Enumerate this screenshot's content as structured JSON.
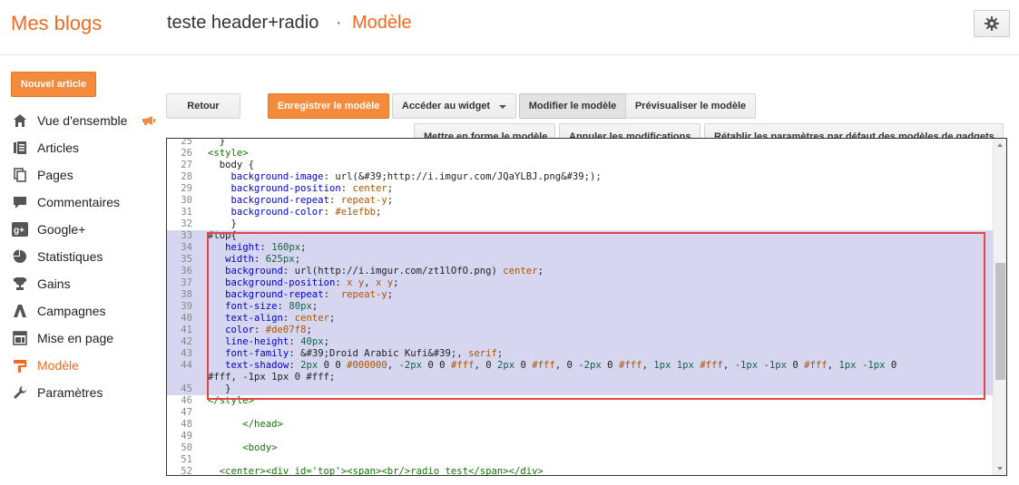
{
  "header": {
    "app_title": "Mes blogs",
    "blog_name": "teste header+radio",
    "separator": "·",
    "section": "Modèle"
  },
  "sidebar": {
    "new_post": "Nouvel article",
    "items": [
      {
        "label": "Vue d'ensemble",
        "icon": "overview-icon"
      },
      {
        "label": "Articles",
        "icon": "posts-icon"
      },
      {
        "label": "Pages",
        "icon": "pages-icon"
      },
      {
        "label": "Commentaires",
        "icon": "comments-icon"
      },
      {
        "label": "Google+",
        "icon": "google-plus-icon"
      },
      {
        "label": "Statistiques",
        "icon": "stats-icon"
      },
      {
        "label": "Gains",
        "icon": "earnings-icon"
      },
      {
        "label": "Campagnes",
        "icon": "campaigns-icon"
      },
      {
        "label": "Mise en page",
        "icon": "layout-icon"
      },
      {
        "label": "Modèle",
        "icon": "template-icon",
        "active": true
      },
      {
        "label": "Paramètres",
        "icon": "settings-icon"
      }
    ]
  },
  "toolbar": {
    "back": "Retour",
    "save": "Enregistrer le modèle",
    "goto_widget": "Accéder au widget",
    "edit": "Modifier le modèle",
    "preview": "Prévisualiser le modèle",
    "format": "Mettre en forme le modèle",
    "undo": "Annuler les modifications",
    "reset_gadgets": "Rétablir les paramètres par défaut des modèles de gadgets"
  },
  "colors": {
    "accent": "#f06b22",
    "button_orange": "#f48a3b",
    "selection": "#d6d6f0",
    "highlight_border": "#e04848"
  },
  "code": {
    "lines": [
      {
        "n": "25",
        "t": "  }"
      },
      {
        "n": "26",
        "t": "<style>"
      },
      {
        "n": "27",
        "t": "  body {"
      },
      {
        "n": "28",
        "t": "    background-image: url(&#39;http://i.imgur.com/JQaYLBJ.png&#39;);"
      },
      {
        "n": "29",
        "t": "    background-position: center;"
      },
      {
        "n": "30",
        "t": "    background-repeat: repeat-y;"
      },
      {
        "n": "31",
        "t": "    background-color: #e1efbb;"
      },
      {
        "n": "32",
        "t": "    }"
      },
      {
        "n": "33",
        "t": "#top{"
      },
      {
        "n": "34",
        "t": "   height: 160px;"
      },
      {
        "n": "35",
        "t": "   width: 625px;"
      },
      {
        "n": "36",
        "t": "   background: url(http://i.imgur.com/zt1lOfO.png) center;"
      },
      {
        "n": "37",
        "t": "   background-position: x y, x y;"
      },
      {
        "n": "38",
        "t": "   background-repeat:  repeat-y;"
      },
      {
        "n": "39",
        "t": "   font-size: 80px;"
      },
      {
        "n": "40",
        "t": "   text-align: center;"
      },
      {
        "n": "41",
        "t": "   color: #de07f8;"
      },
      {
        "n": "42",
        "t": "   line-height: 40px;"
      },
      {
        "n": "43",
        "t": "   font-family: &#39;Droid Arabic Kufi&#39;, serif;"
      },
      {
        "n": "44",
        "t": "   text-shadow: 2px 0 0 #000000, -2px 0 0 #fff, 0 2px 0 #fff, 0 -2px 0 #fff, 1px 1px #fff, -1px -1px 0 #fff, 1px -1px 0",
        "cont": "#fff, -1px 1px 0 #fff;"
      },
      {
        "n": "45",
        "t": "   }"
      },
      {
        "n": "46",
        "t": "</style>"
      },
      {
        "n": "47",
        "t": ""
      },
      {
        "n": "48",
        "t": "      </head>"
      },
      {
        "n": "49",
        "t": ""
      },
      {
        "n": "50",
        "t": "      <body>"
      },
      {
        "n": "51",
        "t": ""
      },
      {
        "n": "52",
        "t": "  <center><div id='top'><span><br/>radio test</span></div>"
      }
    ]
  }
}
